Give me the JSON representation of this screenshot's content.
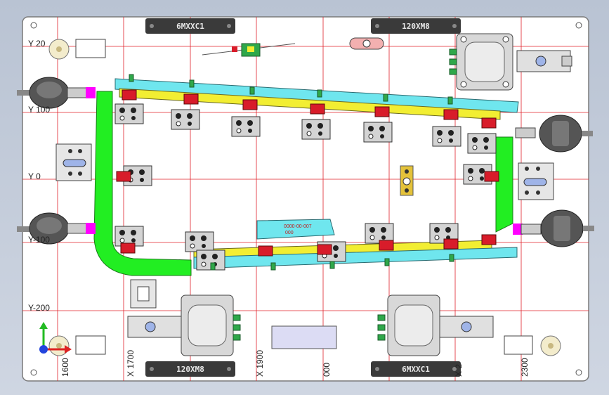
{
  "viewport": {
    "background": "#c3cbd8"
  },
  "plate": {
    "color": "#ffffff",
    "edge": "#7a7a7a"
  },
  "grid": {
    "color": "#e0202a"
  },
  "colors": {
    "fixture_green": "#22ee22",
    "rail_cyan": "#6fe6ee",
    "rail_yellow": "#f2ee32",
    "clamp_red": "#d81c2a",
    "block_gray": "#d4d4d4",
    "connector_magenta": "#ff00ff",
    "nameplate": "#dcdcf4"
  },
  "axis_labels": {
    "y20": "Y 20",
    "y100": "Y 100",
    "y0": "Y 0",
    "ym100": "Y-100",
    "ym200": "Y-200",
    "x1600": "1600",
    "x1700": "X 1700",
    "x1900": "X 1900",
    "x2000": "000",
    "x2200": "X 2",
    "x2300": "2300"
  },
  "label_plates": {
    "top_left": "6MXXC1",
    "top_right": "120XM8",
    "bottom_left": "120XM8",
    "bottom_right": "6MXXC1"
  },
  "part_label": {
    "line1": "0000-00-007",
    "line2": "000"
  },
  "icons": {
    "triad": "xyz-triad-icon",
    "locator_pin": "locator-pin-icon",
    "dial_gauge": "dial-gauge-icon",
    "toggle_clamp": "toggle-clamp-icon",
    "cylinder": "cylinder-icon"
  }
}
